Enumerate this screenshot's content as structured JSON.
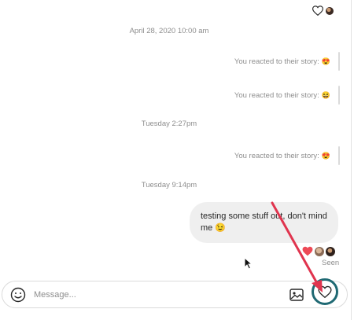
{
  "header": {
    "reaction_icon": "heart-outline-icon",
    "avatar": "user-avatar"
  },
  "thread": {
    "timestamps": [
      "April 28, 2020 10:00 am",
      "Tuesday 2:27pm",
      "Tuesday 9:14pm"
    ],
    "reactions": [
      {
        "text": "You reacted to their story:",
        "emoji": "😍"
      },
      {
        "text": "You reacted to their story:",
        "emoji": "😆"
      },
      {
        "text": "You reacted to their story:",
        "emoji": "😍"
      }
    ],
    "message": {
      "text": "testing some stuff out, don't mind me 😉"
    },
    "seen_label": "Seen"
  },
  "composer": {
    "placeholder": "Message...",
    "emoji_icon": "smiley-icon",
    "gallery_icon": "image-icon",
    "like_icon": "heart-outline-icon"
  },
  "colors": {
    "annotation_arrow": "#e0344e",
    "highlight_ring": "#1f6973",
    "bubble": "#efefef",
    "meta_text": "#8e8e8e"
  }
}
